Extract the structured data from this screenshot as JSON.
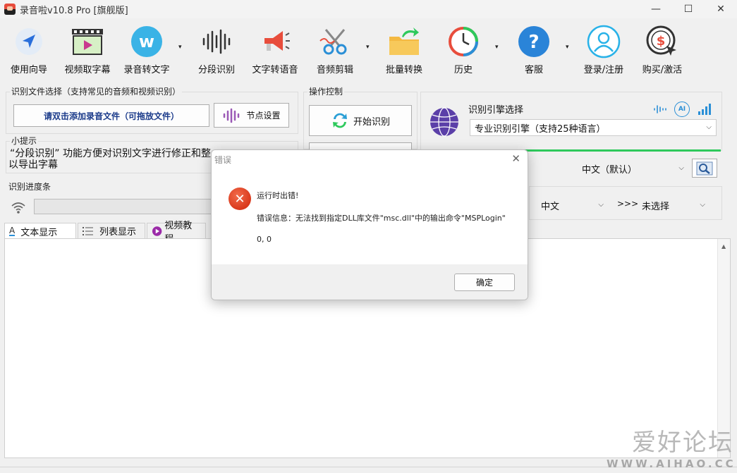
{
  "window": {
    "title": "录音啦v10.8 Pro [旗舰版]",
    "minimize": "—",
    "maximize": "☐",
    "close": "✕"
  },
  "toolbar": {
    "items": [
      {
        "label": "使用向导",
        "icon": "navigation-arrow-icon"
      },
      {
        "label": "视频取字幕",
        "icon": "film-play-icon"
      },
      {
        "label": "录音转文字",
        "icon": "w-logo-icon"
      },
      {
        "label": "分段识别",
        "icon": "sound-wave-icon"
      },
      {
        "label": "文字转语音",
        "icon": "megaphone-icon"
      },
      {
        "label": "音频剪辑",
        "icon": "scissors-icon"
      },
      {
        "label": "批量转换",
        "icon": "folder-arrow-icon"
      },
      {
        "label": "历史",
        "icon": "history-clock-icon"
      },
      {
        "label": "客服",
        "icon": "help-question-icon"
      },
      {
        "label": "登录/注册",
        "icon": "user-icon"
      },
      {
        "label": "购买/激活",
        "icon": "dollar-cursor-icon"
      }
    ],
    "caret": "▾"
  },
  "file_select": {
    "title": "识别文件选择（支持常见的音频和视频识别）",
    "add_button": "请双击添加录音文件（可拖放文件）",
    "node_button": "节点设置"
  },
  "tips": {
    "title": "小提示",
    "text_line1": "“分段识别” 功能方便对识别文字进行修正和整",
    "text_line2": "以导出字幕"
  },
  "progress": {
    "title": "识别进度条"
  },
  "operation": {
    "title": "操作控制",
    "start_button": "开始识别"
  },
  "engine": {
    "title": "识别引擎选择",
    "selected": "专业识别引擎（支持25种语言）",
    "ai_badge": "AI",
    "language": "中文（默认）",
    "source_lang": "中文",
    "arrows": ">>>",
    "target_lang": "未选择"
  },
  "tabs": [
    {
      "label": "文本显示"
    },
    {
      "label": "列表显示"
    },
    {
      "label": "视频教程"
    }
  ],
  "dialog": {
    "title": "错误",
    "close": "✕",
    "icon_mark": "✕",
    "line1": "运行时出错!",
    "line2": "错误信息：无法找到指定DLL库文件\"msc.dll\"中的输出命令\"MSPLogin\"",
    "line3": "0, 0",
    "ok_button": "确定"
  },
  "watermark": {
    "big": "爱好论坛",
    "small": "WWW.AIHAO.CC"
  },
  "colors": {
    "accent_green": "#2ec95c",
    "error_red": "#e0462a",
    "link_blue": "#1a3a8a"
  }
}
